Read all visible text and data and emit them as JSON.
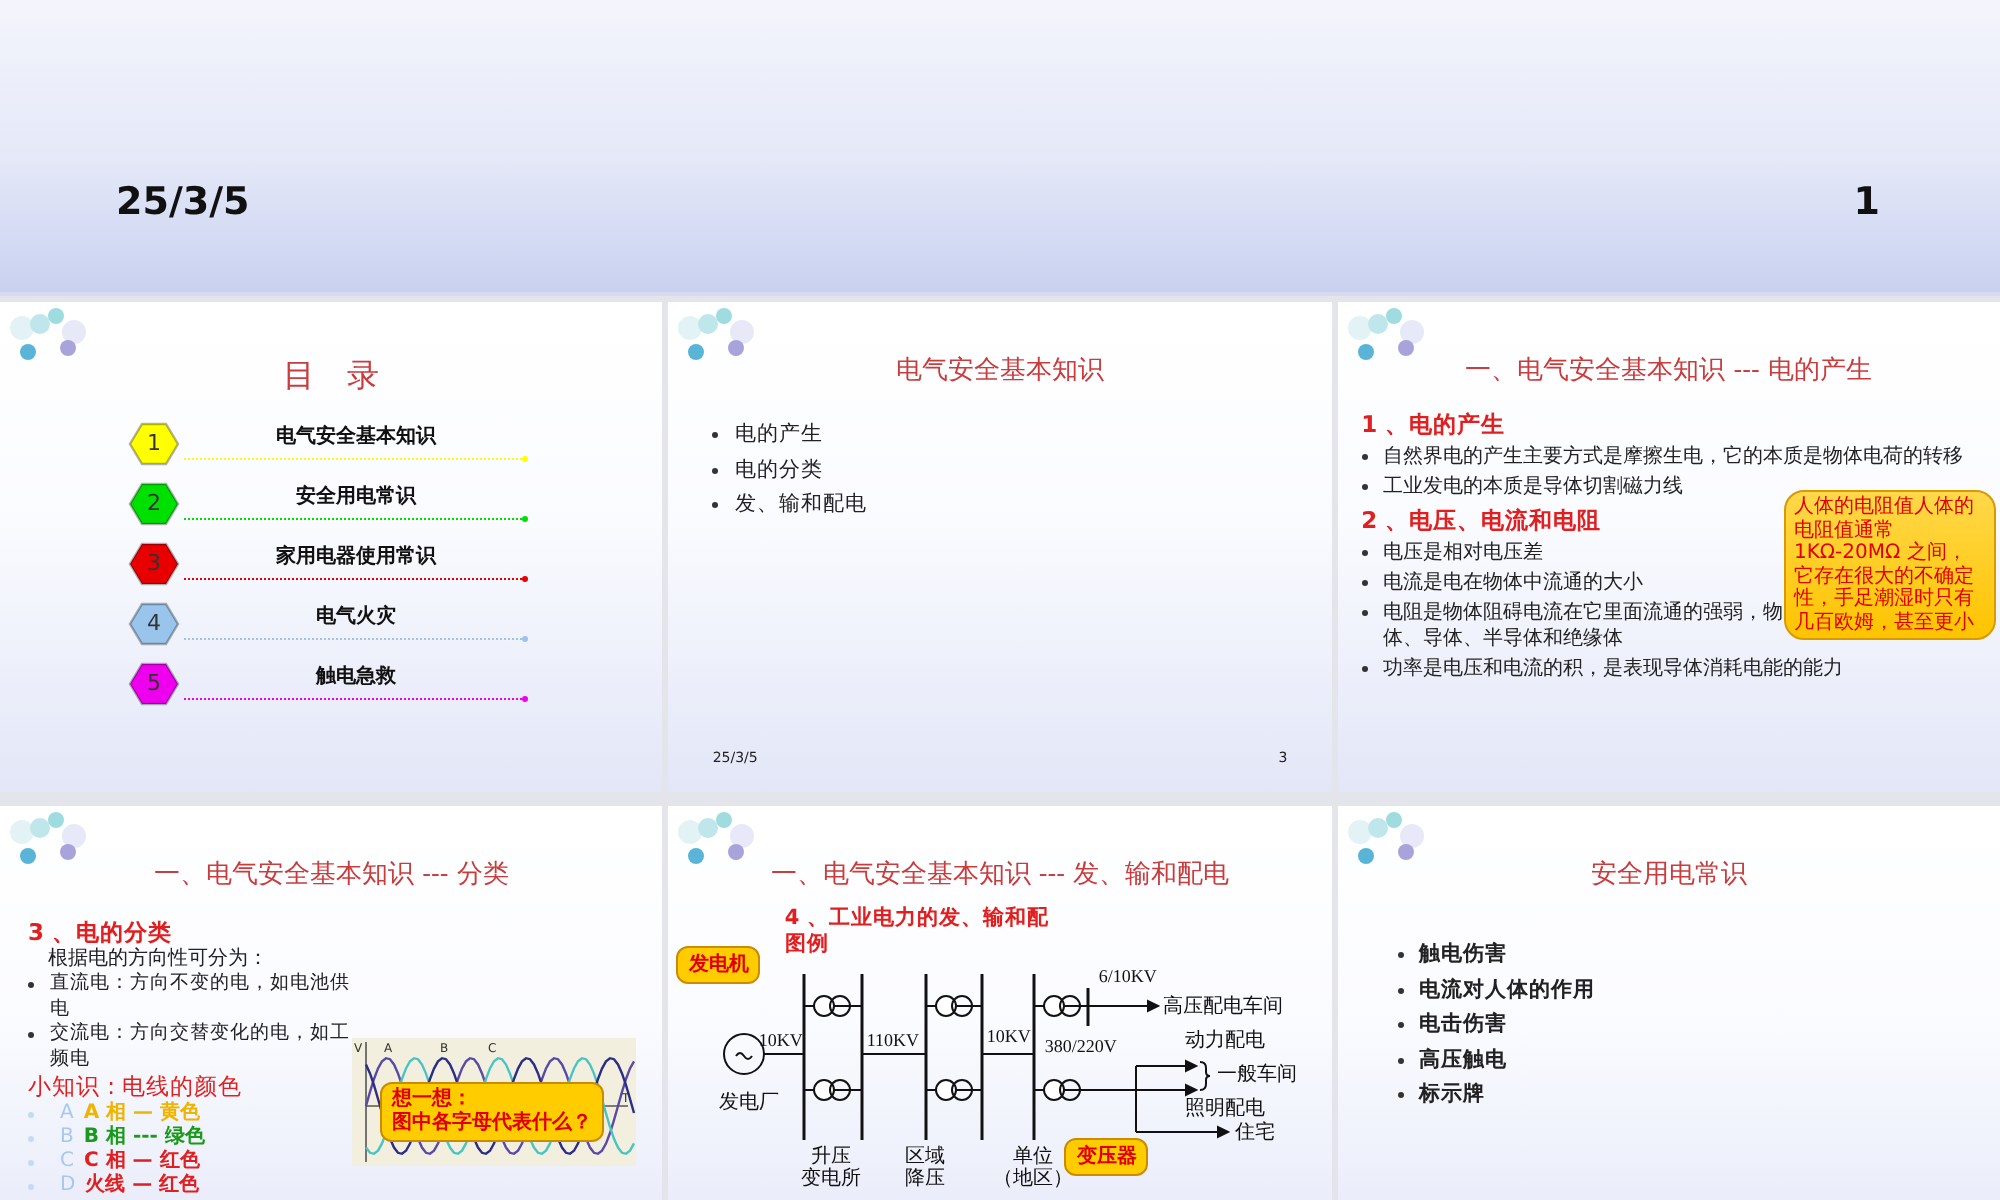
{
  "header": {
    "date": "25/3/5",
    "page": "1"
  },
  "slides": [
    {
      "kind": "toc",
      "title": "目　录",
      "items": [
        {
          "number": "1",
          "label": "电气安全基本知识",
          "color": "#ffff00"
        },
        {
          "number": "2",
          "label": "安全用电常识",
          "color": "#00e000"
        },
        {
          "number": "3",
          "label": "家用电器使用常识",
          "color": "#e80000"
        },
        {
          "number": "4",
          "label": "电气火灾",
          "color": "#99c4ec"
        },
        {
          "number": "5",
          "label": "触电急救",
          "color": "#ee00ee"
        }
      ]
    },
    {
      "kind": "bullets",
      "title": "电气安全基本知识",
      "bullets": [
        "电的产生",
        "电的分类",
        "发、输和配电"
      ],
      "footer": {
        "date": "25/3/5",
        "page": "3"
      }
    },
    {
      "kind": "sections",
      "title": "一、电气安全基本知识 --- 电的产生",
      "sections": [
        {
          "heading": "1 、电的产生",
          "bullets": [
            {
              "lines": [
                "自然界电的产生主要方式是摩擦生电，它的本质是物体电荷的转移"
              ]
            },
            {
              "lines": [
                "工业发电的本质是导体切割磁力线"
              ]
            }
          ]
        },
        {
          "heading": "2 、电压、电流和电阻",
          "bullets": [
            {
              "lines": [
                "电压是相对电压差"
              ]
            },
            {
              "lines": [
                "电流是电在物体中流通的大小"
              ]
            },
            {
              "lines": [
                "电阻是物体阻碍电流在它里面流通的强弱，物",
                "体、导体、半导体和绝缘体"
              ]
            },
            {
              "lines": [
                "功率是电压和电流的积，是表现导体消耗电能的能力"
              ]
            }
          ]
        }
      ],
      "callout": "人体的电阻值人体的电阻值通常 1KΩ-20MΩ 之间，它存在很大的不确定性，手足潮湿时只有几百欧姆，甚至更小"
    },
    {
      "kind": "classification",
      "title": "一、电气安全基本知识 --- 分类",
      "heading": "3 、电的分类",
      "intro": "根据电的方向性可分为：",
      "bullets": [
        {
          "lines": [
            "直流电：方向不变的电，如电池供",
            "电"
          ]
        },
        {
          "lines": [
            "交流电：方向交替变化的电，如工",
            "频电"
          ]
        }
      ],
      "subheading": "小知识 : 电线的颜色",
      "wires": [
        {
          "marker": "A",
          "text": "A 相 — 黄色",
          "color": "#f0b400"
        },
        {
          "marker": "B",
          "text": "B 相 --- 绿色",
          "color": "#1a9a1a"
        },
        {
          "marker": "C",
          "text": "C 相 — 红色",
          "color": "#e02020"
        },
        {
          "marker": "D",
          "text": "火线 — 红色",
          "color": "#e02020"
        }
      ],
      "wave_labels": [
        "V",
        "A",
        "B",
        "C",
        "T"
      ],
      "callout": [
        "想一想：",
        "图中各字母代表什么？"
      ]
    },
    {
      "kind": "diagram",
      "title": "一、电气安全基本知识 --- 发、输和配电",
      "heading": [
        "4 、工业电力的发、输和配",
        "图例"
      ],
      "labels": [
        "6/10KV",
        "高压配电车间",
        "10KV",
        "110KV",
        "10KV",
        "380/220V",
        "动力配电",
        "一般车间",
        "发电厂",
        "照明配电",
        "住宅"
      ],
      "stations": [
        [
          "升压",
          "变电所"
        ],
        [
          "区域",
          "降压"
        ],
        [
          "单位",
          "（地区）"
        ]
      ],
      "callouts": [
        "发电机",
        "变压器"
      ]
    },
    {
      "kind": "bullets",
      "title": "安全用电常识",
      "bullets": [
        "触电伤害",
        "电流对人体的作用",
        "电击伤害",
        "高压触电",
        "标示牌"
      ]
    }
  ]
}
